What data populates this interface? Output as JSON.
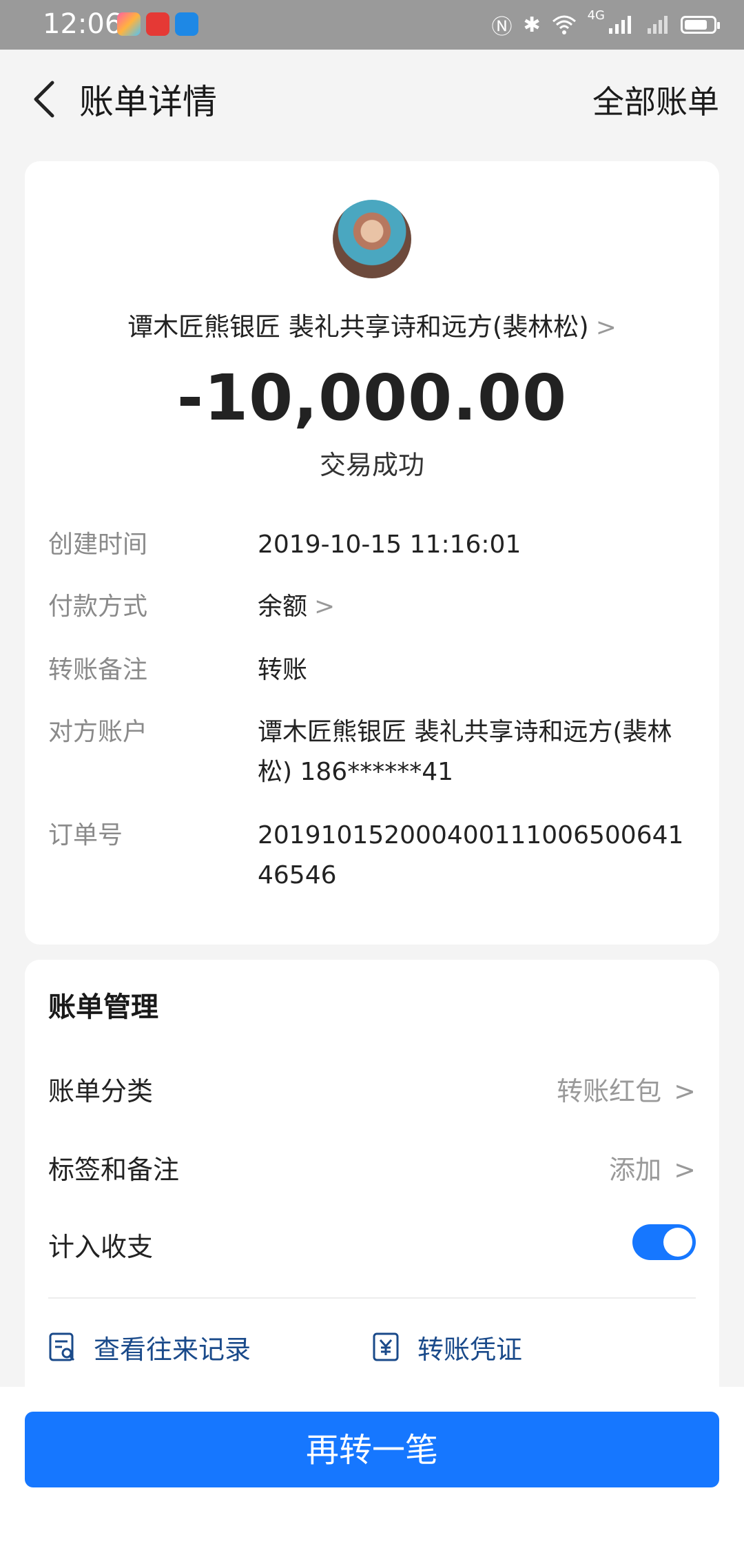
{
  "status_bar": {
    "time": "12:06",
    "network": "4G"
  },
  "header": {
    "title": "账单详情",
    "right_link": "全部账单"
  },
  "transaction": {
    "payee": "谭木匠熊银匠 裴礼共享诗和远方(裴林松)",
    "amount": "-10,000.00",
    "status": "交易成功"
  },
  "details": [
    {
      "label": "创建时间",
      "value": "2019-10-15 11:16:01"
    },
    {
      "label": "付款方式",
      "value": "余额"
    },
    {
      "label": "转账备注",
      "value": "转账"
    },
    {
      "label": "对方账户",
      "value": "谭木匠熊银匠 裴礼共享诗和远方(裴林松) 186******41"
    },
    {
      "label": "订单号",
      "value": "20191015200040011100650064146546"
    }
  ],
  "management": {
    "title": "账单管理",
    "rows": [
      {
        "label": "账单分类",
        "value": "转账红包"
      },
      {
        "label": "标签和备注",
        "value": "添加"
      },
      {
        "label": "计入收支",
        "toggle_on": true
      }
    ],
    "links": [
      {
        "label": "查看往来记录",
        "icon": "records-icon"
      },
      {
        "label": "转账凭证",
        "icon": "voucher-icon"
      }
    ]
  },
  "bottom_button": "再转一笔",
  "colors": {
    "primary": "#1677ff",
    "link": "#1a4a8a",
    "background": "#f4f4f4"
  }
}
